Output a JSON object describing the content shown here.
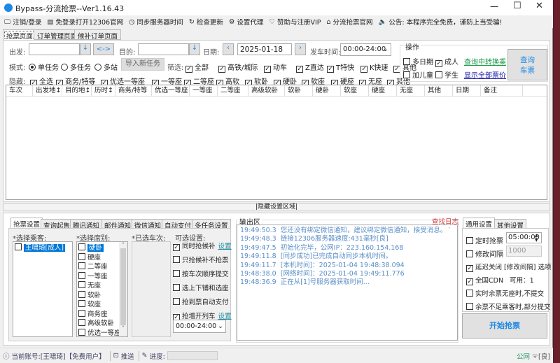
{
  "title": "Bypass-分流抢票--Ver1.16.43",
  "toolbar": [
    {
      "icon": "monitor-icon",
      "label": "注销/登录"
    },
    {
      "icon": "browser-icon",
      "label": "免登录打开12306官网"
    },
    {
      "icon": "clock-icon",
      "label": "同步服务器时间"
    },
    {
      "icon": "refresh-icon",
      "label": "检查更新"
    },
    {
      "icon": "gear-icon",
      "label": "设置代理"
    },
    {
      "icon": "heart-icon",
      "label": "赞助与注册VIP"
    },
    {
      "icon": "home-icon",
      "label": "分流抢票官网"
    },
    {
      "icon": "speaker-icon",
      "label": "公告: 本程序完全免费，谨防上当受骗!"
    }
  ],
  "tabs": [
    "抢票页面",
    "订单管理页面",
    "候补订单页面"
  ],
  "search": {
    "from_label": "出发:",
    "from_value": "",
    "swap_label": "<->",
    "to_label": "目的:",
    "to_value": "",
    "date_label": "日期:",
    "date_value": "2025-01-18",
    "time_label": "发车时间:",
    "time_value": "00:00-24:00"
  },
  "mode": {
    "label": "模式:",
    "options": [
      {
        "label": "单任务",
        "checked": true
      },
      {
        "label": "多任务",
        "checked": false
      },
      {
        "label": "多站",
        "checked": false
      }
    ],
    "import_button": "导入新任务"
  },
  "filter": {
    "label": "筛选:",
    "items": [
      {
        "label": "全部",
        "checked": true
      },
      {
        "label": "高铁/城际",
        "checked": true
      },
      {
        "label": "动车",
        "checked": true
      },
      {
        "label": "Z直达",
        "checked": true
      },
      {
        "label": "T特快",
        "checked": true
      },
      {
        "label": "K快速",
        "checked": true
      },
      {
        "label": "其他",
        "checked": true
      }
    ]
  },
  "hide": {
    "label": "隐藏:",
    "items": [
      {
        "label": "全选",
        "checked": true
      },
      {
        "label": "商务/特等",
        "checked": true
      },
      {
        "label": "优选一等座",
        "checked": true
      },
      {
        "label": "一等座",
        "checked": true
      },
      {
        "label": "二等座",
        "checked": true
      },
      {
        "label": "高软",
        "checked": true
      },
      {
        "label": "软卧",
        "checked": true
      },
      {
        "label": "硬卧",
        "checked": true
      },
      {
        "label": "软座",
        "checked": true
      },
      {
        "label": "硬座",
        "checked": true
      },
      {
        "label": "无座",
        "checked": true
      },
      {
        "label": "其他",
        "checked": true
      }
    ]
  },
  "operation": {
    "title": "操作",
    "items": [
      {
        "label": "多日期",
        "checked": false
      },
      {
        "label": "成人",
        "checked": true
      },
      {
        "label": "加儿童",
        "checked": false
      },
      {
        "label": "学生",
        "checked": false
      }
    ],
    "transfer_link": "查询中转换乘",
    "price_link": "显示全部票价",
    "query_button": [
      "查询",
      "车票"
    ]
  },
  "table": {
    "columns": [
      "车次",
      "出发地↕",
      "目的地↕",
      "历时↕",
      "商务/特等",
      "优选一等座",
      "一等座",
      "二等座",
      "高级软卧",
      "软卧",
      "硬卧",
      "软座",
      "硬座",
      "无座",
      "其他",
      "日期",
      "备注"
    ],
    "rows": []
  },
  "hidden_area_label": "|隐藏设置区域|",
  "bottom_tabs": [
    "抢票设置",
    "查询起售",
    "腾讯通知",
    "邮件通知",
    "微信通知",
    "自动支付",
    "多任务设置"
  ],
  "passengers": {
    "label": "*选择乘客:",
    "items": [
      {
        "label": "王啸琦[成人]",
        "checked": false,
        "selected": true
      }
    ]
  },
  "seats": {
    "label": "*选择席别:",
    "items": [
      {
        "label": "硬卧",
        "selected": true
      },
      {
        "label": "硬座"
      },
      {
        "label": "二等座"
      },
      {
        "label": "一等座"
      },
      {
        "label": "无座"
      },
      {
        "label": "软卧"
      },
      {
        "label": "软座"
      },
      {
        "label": "商务座"
      },
      {
        "label": "高级软卧"
      },
      {
        "label": "优选一等座"
      }
    ]
  },
  "trains": {
    "label": "*已选车次:"
  },
  "optional": {
    "label": "可选设置:",
    "items": [
      {
        "label": "同时抢候补",
        "checked": true,
        "link": "设置"
      },
      {
        "label": "只抢候补不抢票",
        "checked": false
      },
      {
        "label": "按车次顺序提交",
        "checked": false
      },
      {
        "label": "选上下铺和选座",
        "checked": false
      },
      {
        "label": "抢到票自动支付",
        "checked": false
      },
      {
        "label": "抢增开列车",
        "checked": true,
        "link": "设置"
      }
    ],
    "time_value": "00:00-24:00"
  },
  "output": {
    "label": "输出区",
    "find_log": "查找日志",
    "logs": [
      "19:49:50.3  您还没有绑定微信通知，建议绑定微信通知，接受消息。",
      "19:49:48.3  链接12306服务器速度:431毫秒[良]",
      "19:49:47.5  初始化完毕，公网IP：223.160.154.168",
      "19:49:11.8  [同步成功]已完成自动同步本机时间。",
      "19:49:11.7  [本机时间]：2025-01-04 19:48:38.094",
      "19:48:38.0  [网络时间]：2025-01-04 19:49:11.776",
      "19:48:36.9  正在从[1]号服务器获取时间..."
    ]
  },
  "settings": {
    "tabs": [
      "通用设置",
      "其他设置"
    ],
    "timed": {
      "label": "定时抢票",
      "checked": false,
      "value": "05:00:00"
    },
    "interval": {
      "label": "修改间隔",
      "checked": false,
      "value": "1000"
    },
    "items": [
      {
        "label": "延迟关闭 [修改间隔] 选项",
        "checked": true
      },
      {
        "label": "全国CDN   可用：1",
        "checked": true
      },
      {
        "label": "实时余票无座时,不提交",
        "checked": false
      },
      {
        "label": "余票不足乘客时,部分提交",
        "checked": false
      }
    ],
    "start_button": "开始抢票"
  },
  "status": {
    "account": "当前账号:[王啸琦]【免费用户】",
    "push": "推送",
    "progress_label": "进度:",
    "progress": 0,
    "network": "公网",
    "quality": "[良]"
  },
  "colors": {
    "accent": "#0078d7",
    "link_green": "#1a9a4a",
    "link_blue": "#2222aa",
    "find_log": "#d04040",
    "log_text": "#5a8ec7"
  }
}
